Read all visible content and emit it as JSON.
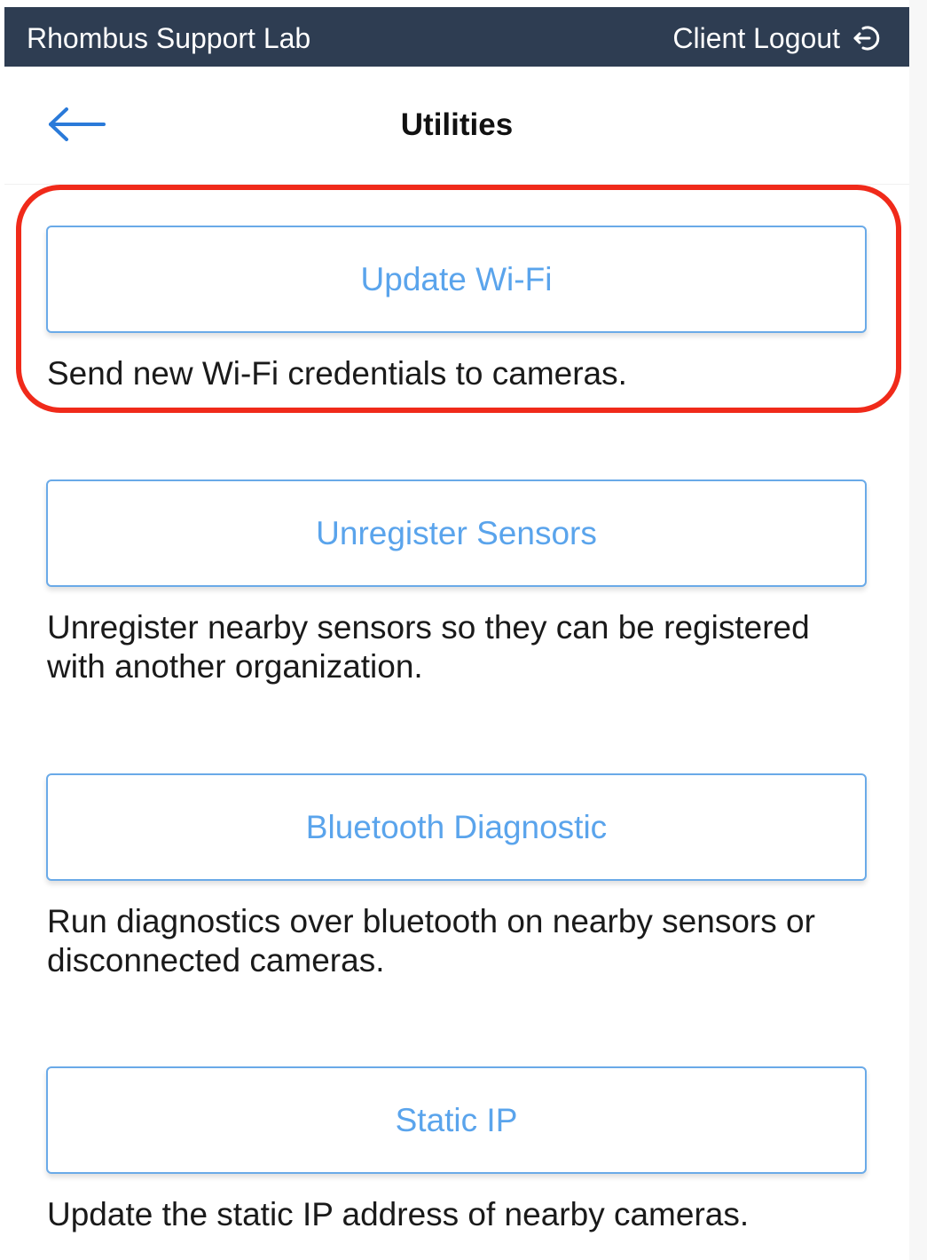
{
  "app": {
    "title": "Rhombus Support Lab",
    "logout_label": "Client Logout",
    "logout_icon": "logout-icon"
  },
  "header": {
    "back_icon": "arrow-left-icon",
    "title": "Utilities"
  },
  "colors": {
    "topbar": "#2e3d52",
    "accent": "#5aa4ec",
    "button_border": "#6aaae8",
    "highlight": "#f02a1a",
    "back_arrow": "#2a7ad9"
  },
  "utilities": [
    {
      "button_label": "Update Wi-Fi",
      "description": "Send new Wi-Fi credentials to cameras."
    },
    {
      "button_label": "Unregister Sensors",
      "description": "Unregister nearby sensors so they can be registered with another organization."
    },
    {
      "button_label": "Bluetooth Diagnostic",
      "description": "Run diagnostics over bluetooth on nearby sensors or disconnected cameras."
    },
    {
      "button_label": "Static IP",
      "description": "Update the static IP address of nearby cameras."
    }
  ]
}
